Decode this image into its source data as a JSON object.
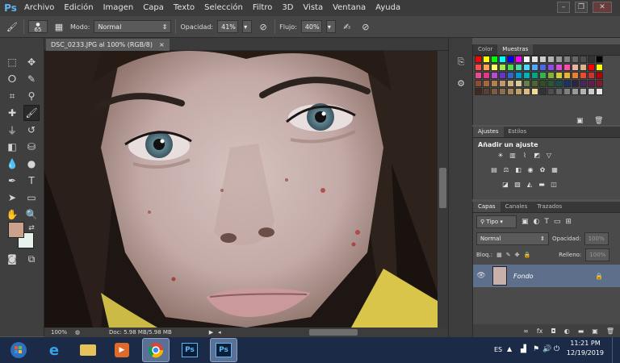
{
  "app": {
    "logo": "Ps"
  },
  "menu": [
    "Archivo",
    "Edición",
    "Imagen",
    "Capa",
    "Texto",
    "Selección",
    "Filtro",
    "3D",
    "Vista",
    "Ventana",
    "Ayuda"
  ],
  "options": {
    "brush_size": "65",
    "mode_label": "Modo:",
    "mode_value": "Normal",
    "opacity_label": "Opacidad:",
    "opacity_value": "41%",
    "flow_label": "Flujo:",
    "flow_value": "40%"
  },
  "document": {
    "tab_title": "DSC_0233.JPG al 100% (RGB/8)",
    "close": "×"
  },
  "status": {
    "zoom": "100%",
    "doc_info": "Doc: 5.98 MB/5.98 MB"
  },
  "panels": {
    "color_tabs": [
      "Color",
      "Muestras"
    ],
    "adjust_tabs": [
      "Ajustes",
      "Estilos"
    ],
    "adjust_title": "Añadir un ajuste",
    "layer_tabs": [
      "Capas",
      "Canales",
      "Trazados"
    ],
    "kind_label": "Tipo",
    "blend_mode": "Normal",
    "opacity_label": "Opacidad:",
    "opacity_value": "100%",
    "lock_label": "Bloq.:",
    "fill_label": "Relleno:",
    "fill_value": "100%",
    "layer_name": "Fondo"
  },
  "colors": {
    "foreground": "#c9a18d",
    "background": "#e6f3ec",
    "swatches": [
      "#ff0000",
      "#ffff00",
      "#00ff00",
      "#00ffff",
      "#0000ff",
      "#ff00ff",
      "#ffffff",
      "#e6e6e6",
      "#cccccc",
      "#b3b3b3",
      "#999999",
      "#808080",
      "#666666",
      "#4d4d4d",
      "#333333",
      "#000000",
      "#ff4d4d",
      "#ffa64d",
      "#ffff66",
      "#a6e64d",
      "#4dd94d",
      "#4dd9a6",
      "#4dd9ff",
      "#4da6ff",
      "#4d66e6",
      "#8c4de6",
      "#d94dd9",
      "#ff4da6",
      "#e6b3a6",
      "#d9b38c",
      "#ff0000",
      "#ffff00",
      "#e64d8c",
      "#e6338c",
      "#b34dcc",
      "#6633cc",
      "#3366cc",
      "#0099cc",
      "#00b3b3",
      "#00a680",
      "#33b34d",
      "#80b333",
      "#cccc33",
      "#e6b333",
      "#e68033",
      "#e64d33",
      "#cc3333",
      "#b30000",
      "#8c4d33",
      "#a6663e",
      "#b3804d",
      "#c09966",
      "#cdb380",
      "#d9c899",
      "#66804d",
      "#4d6633",
      "#334d26",
      "#265933",
      "#1a4d4d",
      "#1a3366",
      "#26264d",
      "#4d2659",
      "#661a4d",
      "#801a33",
      "#3d2b1f",
      "#5c4033",
      "#7a5c40",
      "#8c6e4d",
      "#a68659",
      "#bfa066",
      "#d9bd80",
      "#f2d999",
      "#333333",
      "#4d4d4d",
      "#666666",
      "#808080",
      "#999999",
      "#b3b3b3",
      "#cccccc",
      "#e6e6e6"
    ]
  },
  "taskbar": {
    "language": "ES",
    "time": "11:21 PM",
    "date": "12/19/2019"
  }
}
